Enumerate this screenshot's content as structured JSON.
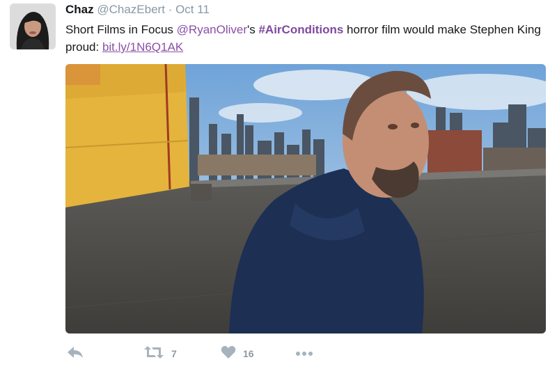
{
  "tweet": {
    "author_name": "Chaz",
    "handle": "@ChazEbert",
    "separator": "·",
    "time": "Oct 11",
    "text_part1": "Short Films in Focus ",
    "mention": "@RyanOliver",
    "text_part2": "'s ",
    "hashtag": "#AirConditions",
    "text_part3": " horror film  would make Stephen King proud: ",
    "link": "bit.ly/1N6Q1AK"
  },
  "actions": {
    "reply_icon": "reply-arrow-icon",
    "retweet_icon": "retweet-icon",
    "retweet_count": "7",
    "like_icon": "heart-icon",
    "like_count": "16",
    "more_icon": "ellipsis-icon"
  },
  "colors": {
    "link_purple": "#8a4fa6",
    "meta_gray": "#8899a6",
    "icon_gray": "#a6b3bd"
  }
}
